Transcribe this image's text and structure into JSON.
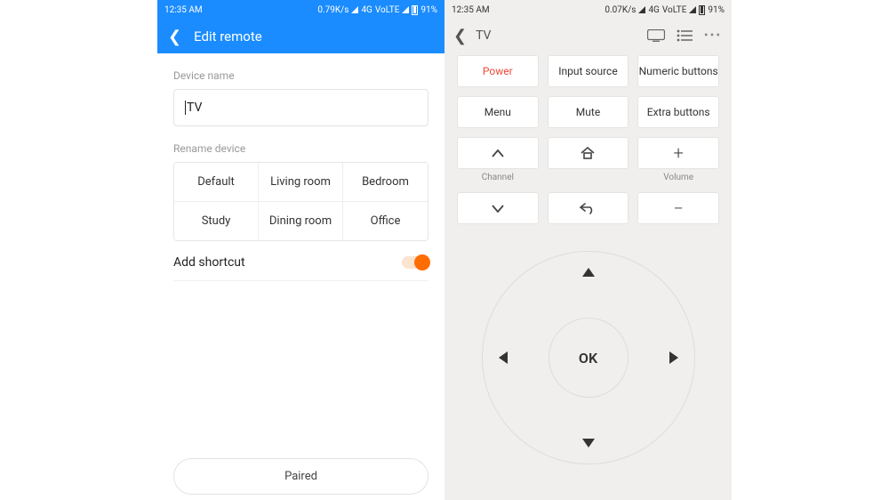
{
  "left": {
    "statusbar": {
      "time": "12:35 AM",
      "net_speed": "0.79K/s",
      "volte": "VoLTE",
      "battery": "91%"
    },
    "header": {
      "title": "Edit remote"
    },
    "device_name_label": "Device name",
    "device_name_value": "TV",
    "rename_label": "Rename device",
    "rename_options": [
      "Default",
      "Living room",
      "Bedroom",
      "Study",
      "Dining room",
      "Office"
    ],
    "shortcut_label": "Add shortcut",
    "shortcut_on": true,
    "paired_label": "Paired"
  },
  "right": {
    "statusbar": {
      "time": "12:35 AM",
      "net_speed": "0.07K/s",
      "volte": "VoLTE",
      "battery": "91%"
    },
    "header": {
      "title": "TV"
    },
    "buttons": {
      "power": "Power",
      "input_source": "Input source",
      "numeric": "Numeric buttons",
      "menu": "Menu",
      "mute": "Mute",
      "extra": "Extra buttons"
    },
    "channel_label": "Channel",
    "volume_label": "Volume",
    "dpad_ok": "OK"
  }
}
